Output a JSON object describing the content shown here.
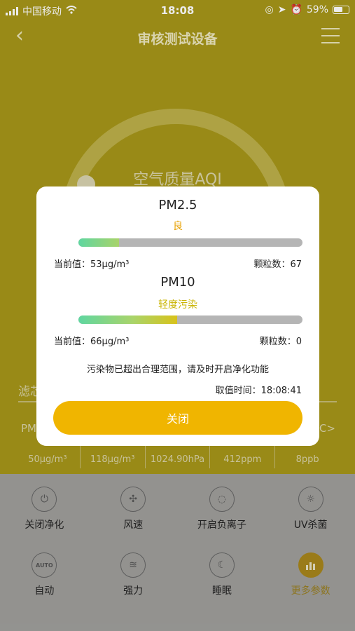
{
  "status_bar": {
    "carrier": "中国移动",
    "time": "18:08",
    "battery": "59%"
  },
  "nav": {
    "title": "审核测试设备",
    "back_icon": "back-chevron-icon",
    "menu_icon": "menu-list-icon"
  },
  "gauge": {
    "label": "空气质量AQI"
  },
  "filter": {
    "label": "滤芯"
  },
  "params_edge": {
    "left": "PM",
    "right": "C>"
  },
  "params": [
    {
      "value": "50μg/m³"
    },
    {
      "value": "118μg/m³"
    },
    {
      "value": "1024.90hPa"
    },
    {
      "value": "412ppm"
    },
    {
      "value": "8ppb"
    }
  ],
  "controls": [
    {
      "label": "关闭净化",
      "icon": "power-icon",
      "glyph": "⏻"
    },
    {
      "label": "风速",
      "icon": "fan-icon",
      "glyph": "✣"
    },
    {
      "label": "开启负离子",
      "icon": "droplet-icon",
      "glyph": "◌"
    },
    {
      "label": "UV杀菌",
      "icon": "sun-icon",
      "glyph": "☼"
    },
    {
      "label": "自动",
      "icon": "auto-icon",
      "glyph": "AUTO"
    },
    {
      "label": "强力",
      "icon": "wind-icon",
      "glyph": "≋"
    },
    {
      "label": "睡眠",
      "icon": "moon-icon",
      "glyph": "☾"
    },
    {
      "label": "更多参数",
      "icon": "bar-chart-icon",
      "glyph": "▮▮▮",
      "active": true
    }
  ],
  "modal": {
    "pm25": {
      "title": "PM2.5",
      "level": "良",
      "level_color": "#e8a100",
      "fill_fraction": 0.18,
      "value_label": "当前值：53μg/m³",
      "count_label": "颗粒数：67"
    },
    "pm10": {
      "title": "PM10",
      "level": "轻度污染",
      "level_color": "#c9b400",
      "fill_fraction": 0.44,
      "value_label": "当前值：66μg/m³",
      "count_label": "颗粒数：0"
    },
    "warning": "污染物已超出合理范围，请及时开启净化功能",
    "time_label": "取值时间：18:08:41",
    "close_label": "关闭"
  }
}
